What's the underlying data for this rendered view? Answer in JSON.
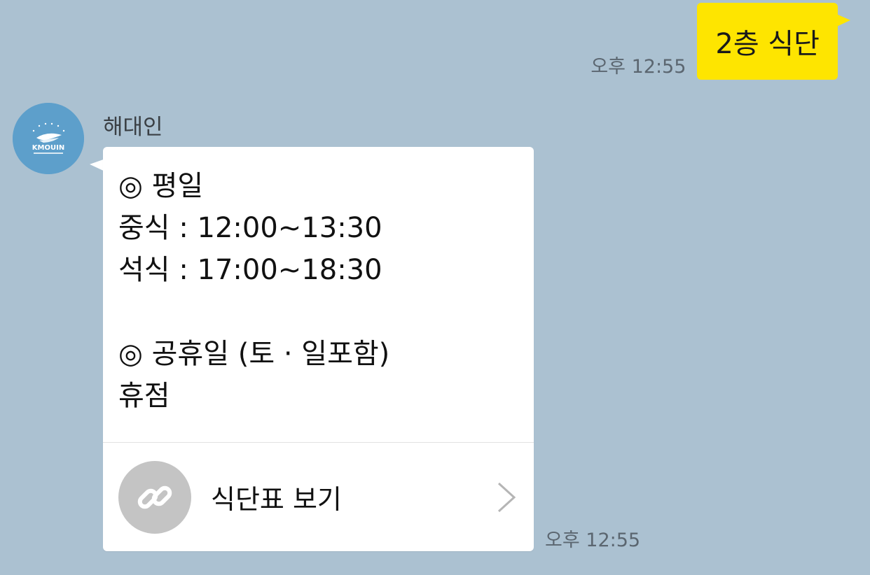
{
  "chat": {
    "background_color": "#abc1d1",
    "outgoing": {
      "text": "2층 식단",
      "time": "오후 12:55",
      "bubble_color": "#fee500"
    },
    "incoming": {
      "sender_name": "해대인",
      "avatar_icon": "kmouin-logo-icon",
      "avatar_text": "KMOUIN",
      "time": "오후 12:55",
      "card": {
        "lines": [
          "◎ 평일",
          "중식 : 12:00~13:30",
          "석식 : 17:00~18:30",
          "",
          "◎ 공휴일 (토 · 일포함)",
          "휴점"
        ],
        "link": {
          "icon": "link-icon",
          "label": "식단표 보기",
          "chevron_icon": "chevron-right-icon"
        }
      }
    }
  }
}
